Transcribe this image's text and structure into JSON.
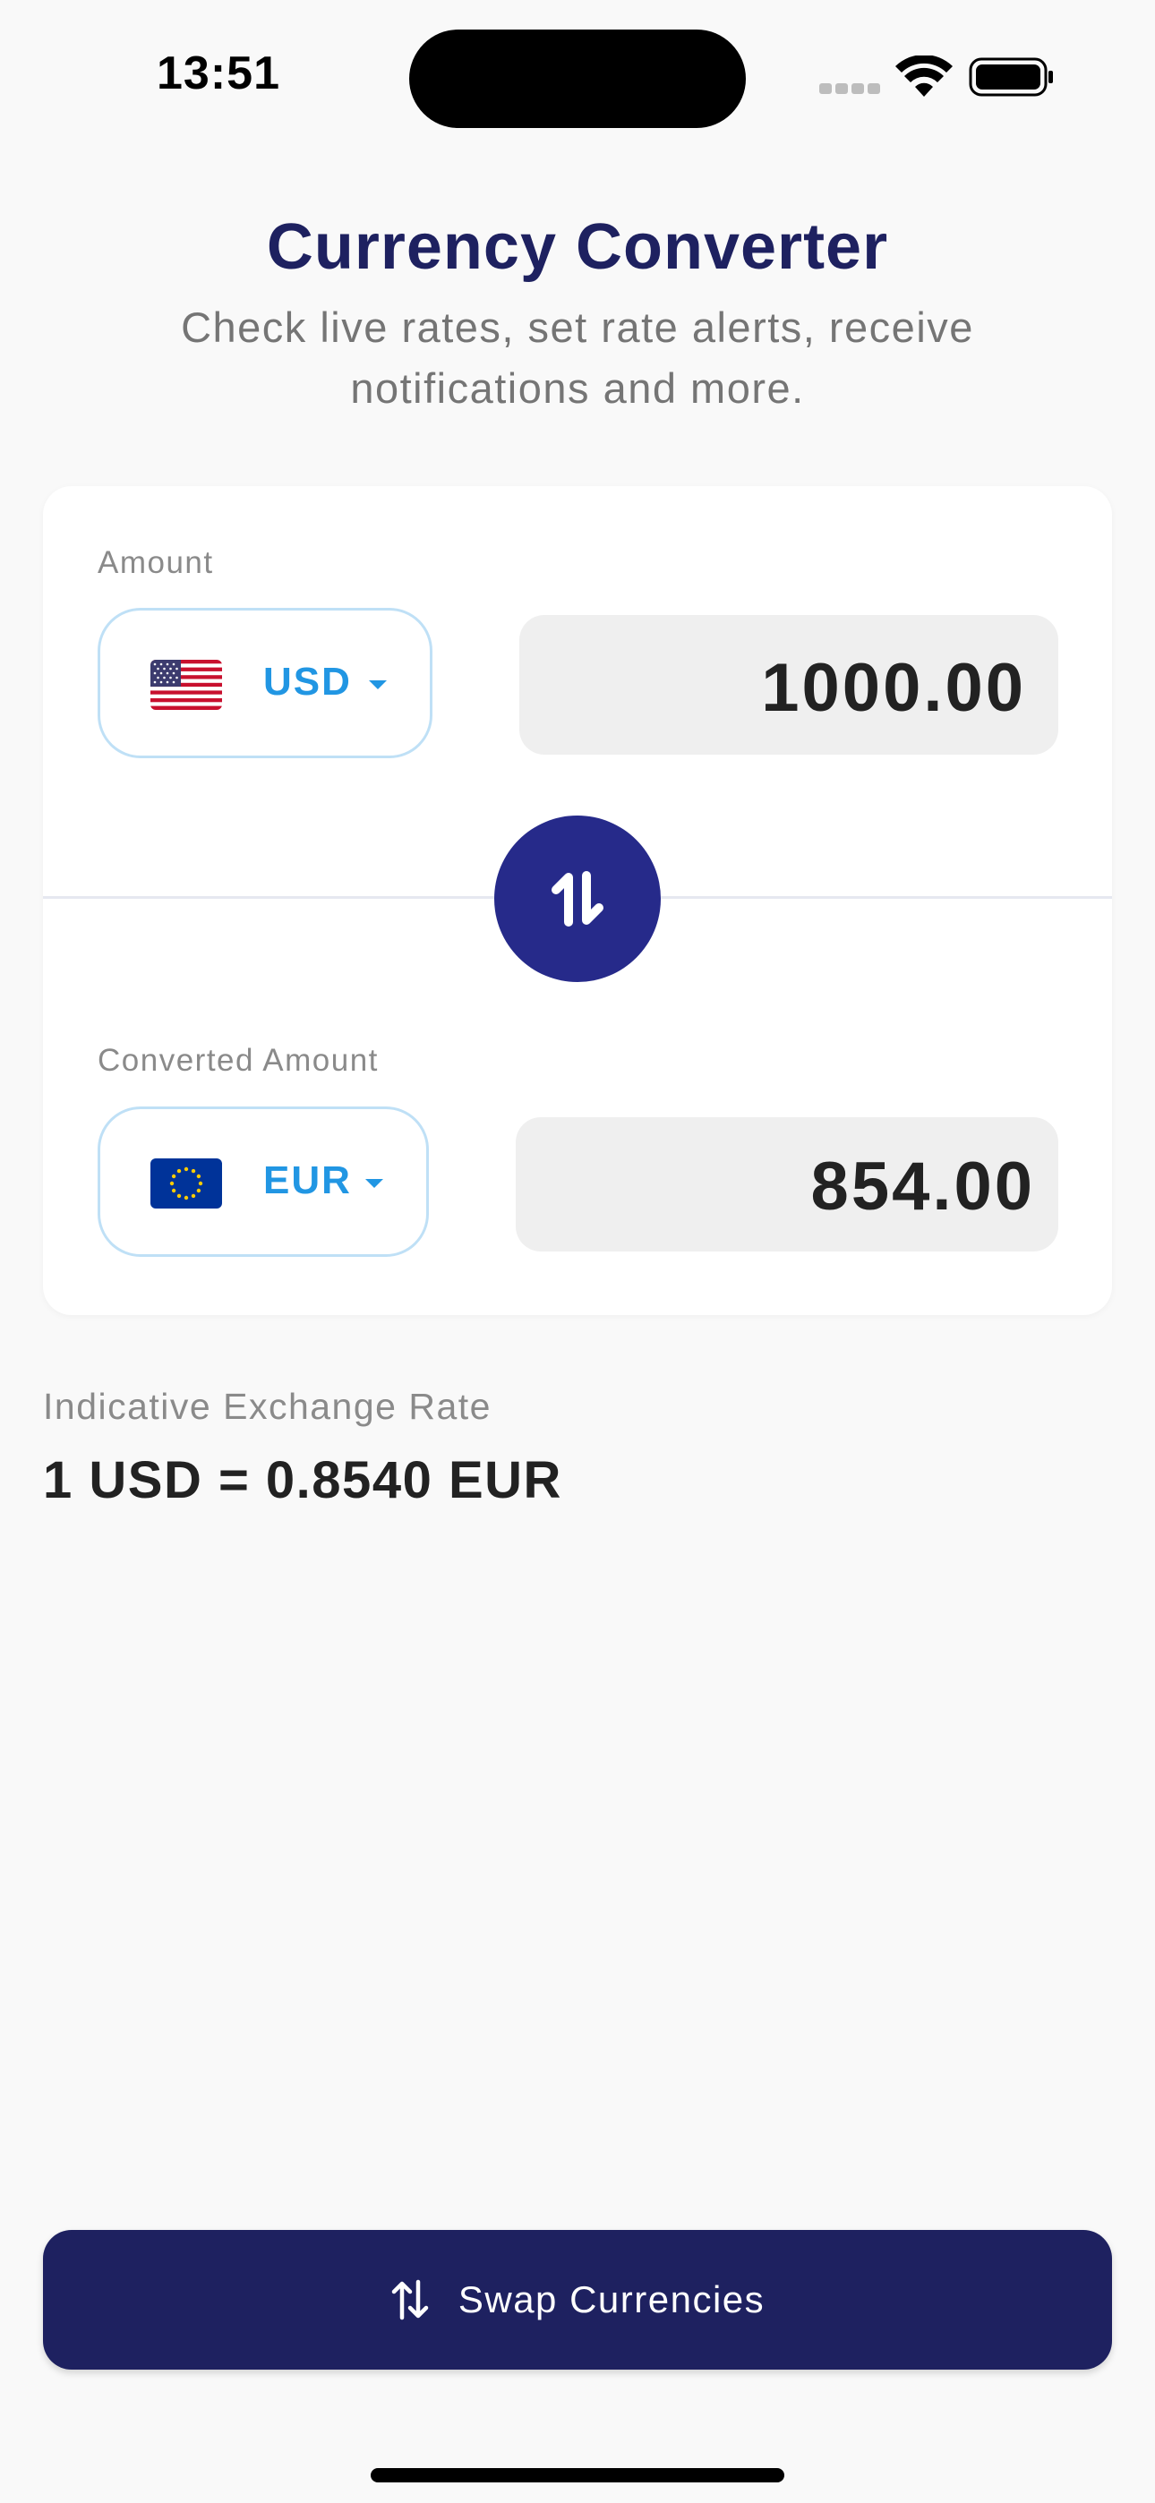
{
  "status_bar": {
    "time": "13:51"
  },
  "header": {
    "title": "Currency Converter",
    "subtitle": "Check live rates, set rate alerts, receive notifications and more."
  },
  "converter": {
    "from": {
      "label": "Amount",
      "currency_code": "USD",
      "flag_icon": "us-flag-icon",
      "amount": "1000.00"
    },
    "to": {
      "label": "Converted Amount",
      "currency_code": "EUR",
      "flag_icon": "eu-flag-icon",
      "amount": "854.00"
    }
  },
  "rate": {
    "label": "Indicative Exchange Rate",
    "value": "1 USD = 0.8540 EUR"
  },
  "swap_button": {
    "label": "Swap Currencies",
    "icon": "swap-vertical-icon"
  },
  "colors": {
    "title": "#1e2160",
    "accent": "#2196e3",
    "swap_circle": "#262a8a",
    "button": "#1e2160"
  }
}
